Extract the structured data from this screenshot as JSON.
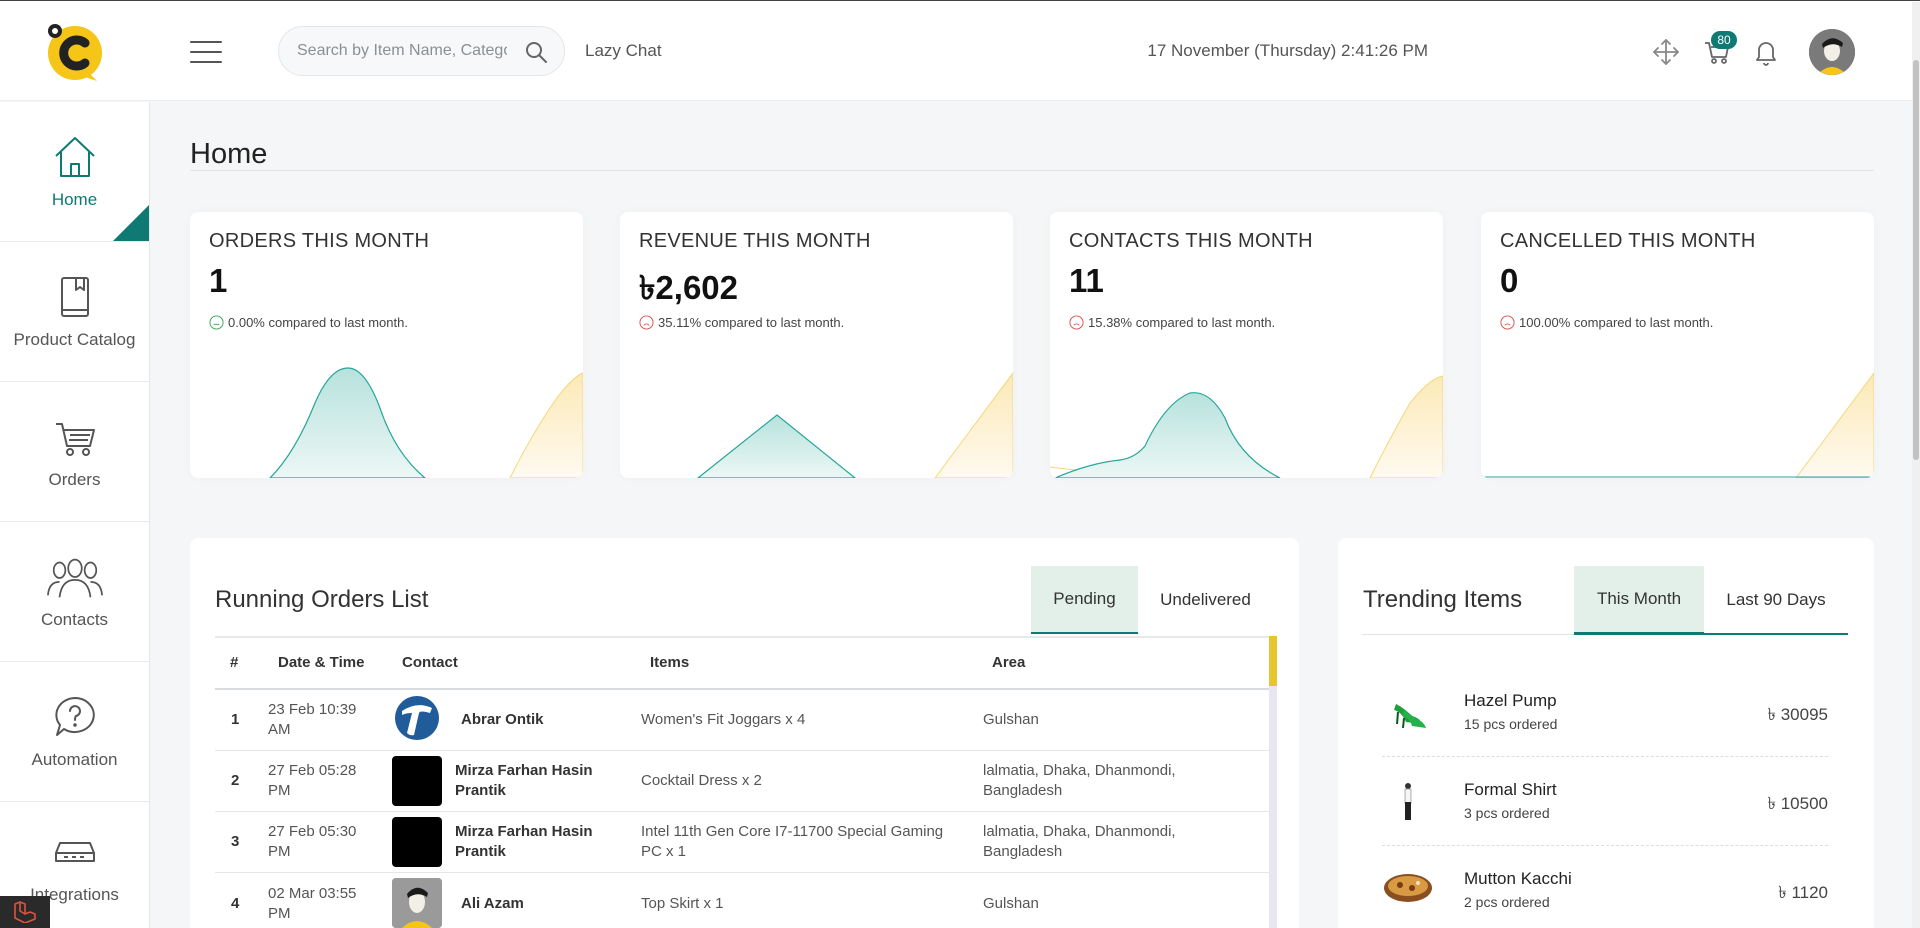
{
  "header": {
    "search_placeholder": "Search by Item Name, Category",
    "lazy_chat_label": "Lazy Chat",
    "datetime": "17 November (Thursday) 2:41:26 PM",
    "cart_count": "80"
  },
  "sidebar": {
    "items": [
      {
        "label": "Home",
        "icon": "home-icon",
        "active": true
      },
      {
        "label": "Product Catalog",
        "icon": "book-icon"
      },
      {
        "label": "Orders",
        "icon": "cart-icon"
      },
      {
        "label": "Contacts",
        "icon": "people-icon"
      },
      {
        "label": "Automation",
        "icon": "question-bubble-icon"
      },
      {
        "label": "Integrations",
        "icon": "router-icon"
      }
    ]
  },
  "page": {
    "title": "Home"
  },
  "stats": [
    {
      "title": "ORDERS THIS MONTH",
      "value": "1",
      "compare": "0.00% compared to last month.",
      "trend": "neutral"
    },
    {
      "title": "REVENUE THIS MONTH",
      "value": "৳2,602",
      "compare": "35.11% compared to last month.",
      "trend": "down"
    },
    {
      "title": "CONTACTS THIS MONTH",
      "value": "11",
      "compare": "15.38% compared to last month.",
      "trend": "down"
    },
    {
      "title": "CANCELLED THIS MONTH",
      "value": "0",
      "compare": "100.00% compared to last month.",
      "trend": "down"
    }
  ],
  "running_orders": {
    "title": "Running Orders List",
    "tabs": [
      {
        "label": "Pending",
        "active": true
      },
      {
        "label": "Undelivered"
      }
    ],
    "columns": [
      "#",
      "Date & Time",
      "Contact",
      "Items",
      "Area"
    ],
    "rows": [
      {
        "num": "1",
        "date_line1": "23 Feb 10:39",
        "date_line2": "AM",
        "contact_line1": "Abrar Ontik",
        "contact_line2": "",
        "items_line1": "Women's Fit Joggars x 4",
        "items_line2": "",
        "area_line1": "Gulshan",
        "area_line2": ""
      },
      {
        "num": "2",
        "date_line1": "27 Feb 05:28",
        "date_line2": "PM",
        "contact_line1": "Mirza Farhan Hasin",
        "contact_line2": "Prantik",
        "items_line1": "Cocktail Dress x 2",
        "items_line2": "",
        "area_line1": "lalmatia, Dhaka, Dhanmondi,",
        "area_line2": "Bangladesh"
      },
      {
        "num": "3",
        "date_line1": "27 Feb 05:30",
        "date_line2": "PM",
        "contact_line1": "Mirza Farhan Hasin",
        "contact_line2": "Prantik",
        "items_line1": "Intel 11th Gen Core I7-11700 Special Gaming",
        "items_line2": "PC x 1",
        "area_line1": "lalmatia, Dhaka, Dhanmondi,",
        "area_line2": "Bangladesh"
      },
      {
        "num": "4",
        "date_line1": "02 Mar 03:55",
        "date_line2": "PM",
        "contact_line1": "Ali Azam",
        "contact_line2": "",
        "items_line1": "Top Skirt x 1",
        "items_line2": "",
        "area_line1": "Gulshan",
        "area_line2": ""
      }
    ]
  },
  "trending": {
    "title": "Trending Items",
    "tabs": [
      {
        "label": "This Month",
        "active": true
      },
      {
        "label": "Last 90 Days"
      }
    ],
    "items": [
      {
        "name": "Hazel Pump",
        "sub": "15 pcs ordered",
        "price": "৳ 30095"
      },
      {
        "name": "Formal Shirt",
        "sub": "3 pcs ordered",
        "price": "৳ 10500"
      },
      {
        "name": "Mutton Kacchi",
        "sub": "2 pcs ordered",
        "price": "৳ 1120"
      }
    ]
  },
  "colors": {
    "accent": "#0e7a73",
    "teal_fill": "#c8e8e4",
    "yellow_fill": "#fdf3d4",
    "yellow_line": "#f3d77a",
    "logo_yellow": "#f5c518"
  }
}
